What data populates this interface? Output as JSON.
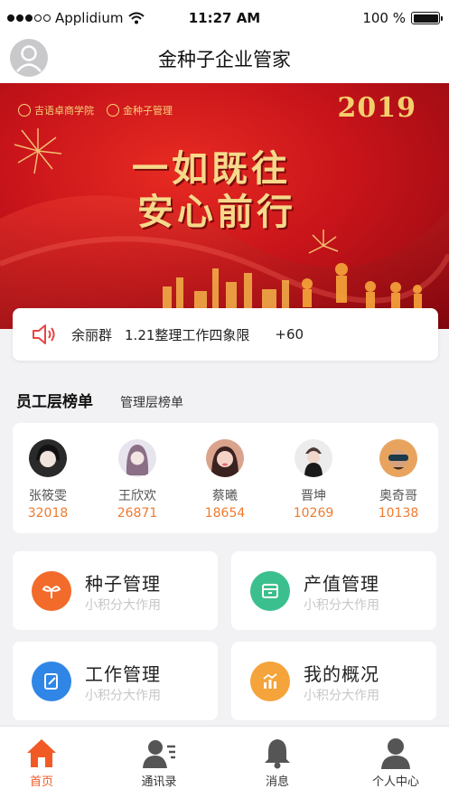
{
  "status_bar": {
    "carrier": "Applidium",
    "time": "11:27 AM",
    "battery": "100 %"
  },
  "header": {
    "title": "金种子企业管家"
  },
  "banner": {
    "logo_left": "吉语卓商学院",
    "logo_right": "金种子管理",
    "year": "2019",
    "line1": "一如既往",
    "line2": "安心前行"
  },
  "notice": {
    "name": "余丽群",
    "text": "1.21整理工作四象限",
    "points": "+60"
  },
  "tabs": {
    "active": "员工层榜单",
    "inactive": "管理层榜单"
  },
  "leaderboard": [
    {
      "name": "张筱雯",
      "score": "32018"
    },
    {
      "name": "王欣欢",
      "score": "26871"
    },
    {
      "name": "蔡曦",
      "score": "18654"
    },
    {
      "name": "晋坤",
      "score": "10269"
    },
    {
      "name": "奥奇哥",
      "score": "10138"
    }
  ],
  "modules": [
    {
      "title": "种子管理",
      "subtitle": "小积分大作用",
      "color": "#f26b2a",
      "icon": "seed-icon"
    },
    {
      "title": "产值管理",
      "subtitle": "小积分大作用",
      "color": "#3cbf8e",
      "icon": "wallet-icon"
    },
    {
      "title": "工作管理",
      "subtitle": "小积分大作用",
      "color": "#2f86e6",
      "icon": "edit-icon"
    },
    {
      "title": "我的概况",
      "subtitle": "小积分大作用",
      "color": "#f5a33b",
      "icon": "chart-icon"
    }
  ],
  "bottom_nav": [
    {
      "label": "首页",
      "active": true
    },
    {
      "label": "通讯录",
      "active": false
    },
    {
      "label": "消息",
      "active": false
    },
    {
      "label": "个人中心",
      "active": false
    }
  ],
  "colors": {
    "accent": "#f15a24",
    "score": "#f07a2e",
    "banner_red": "#c8141a"
  }
}
